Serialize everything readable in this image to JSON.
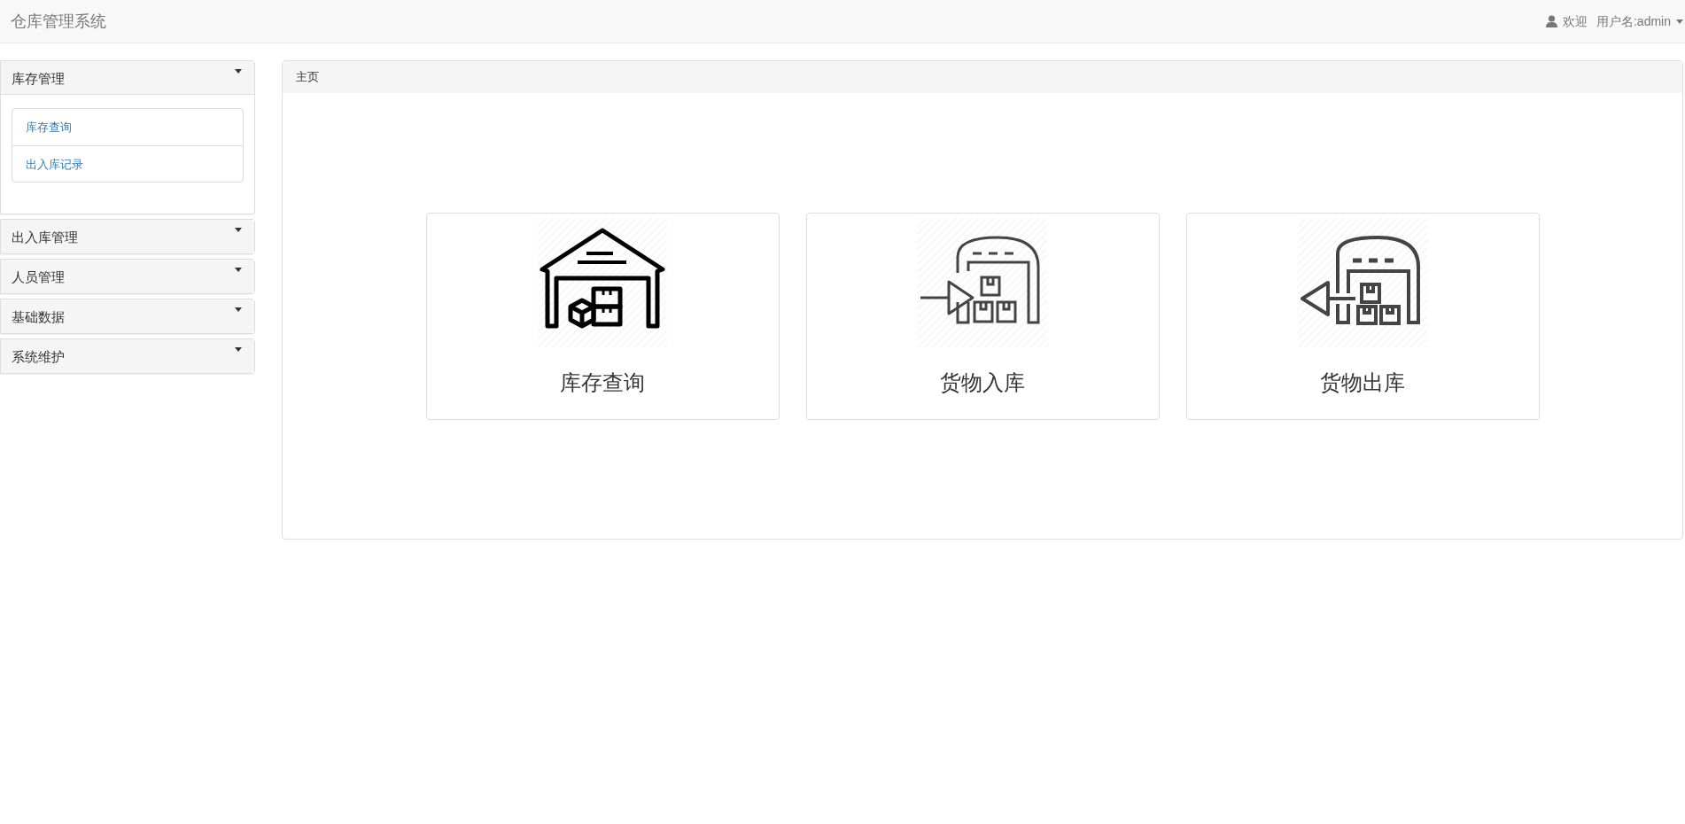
{
  "navbar": {
    "brand": "仓库管理系统",
    "welcome": "欢迎",
    "user": "用户名:admin"
  },
  "sidebar": {
    "sections": [
      {
        "title": "库存管理",
        "expanded": true,
        "items": [
          "库存查询",
          "出入库记录"
        ]
      },
      {
        "title": "出入库管理",
        "expanded": false
      },
      {
        "title": "人员管理",
        "expanded": false
      },
      {
        "title": "基础数据",
        "expanded": false
      },
      {
        "title": "系统维护",
        "expanded": false
      }
    ]
  },
  "main": {
    "title": "主页",
    "cards": [
      {
        "kind": "warehouse",
        "label": "库存查询"
      },
      {
        "kind": "inbound",
        "label": "货物入库"
      },
      {
        "kind": "outbound",
        "label": "货物出库"
      }
    ]
  }
}
